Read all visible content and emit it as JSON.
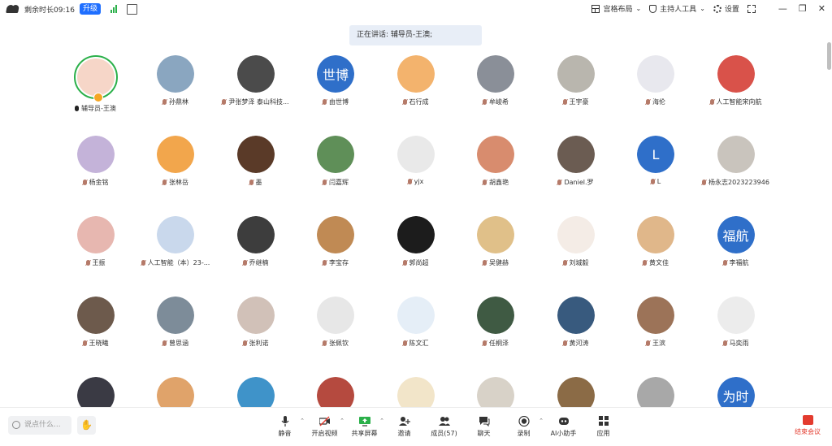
{
  "topbar": {
    "remaining_time": "剩余时长09:16",
    "upgrade_label": "升级",
    "layout_label": "宫格布局",
    "host_tools_label": "主持人工具",
    "settings_label": "设置"
  },
  "speaking": "正在讲话: 辅导员-王澳;",
  "participants": [
    {
      "name": "辅导员-王澳",
      "color": "#f6d6c8",
      "text": "",
      "speaker": true
    },
    {
      "name": "孙鼎林",
      "color": "#8aa6c0",
      "text": ""
    },
    {
      "name": "尹张梦泽 泰山科技...",
      "color": "#4b4b4b",
      "text": ""
    },
    {
      "name": "由世博",
      "color": "#2f6fc9",
      "text": "世博"
    },
    {
      "name": "石行成",
      "color": "#f3b36d",
      "text": ""
    },
    {
      "name": "牟峻希",
      "color": "#8a8f98",
      "text": ""
    },
    {
      "name": "王宇豪",
      "color": "#b9b6ae",
      "text": ""
    },
    {
      "name": "海伦",
      "color": "#e8e8ee",
      "text": ""
    },
    {
      "name": "人工智能宋向航",
      "color": "#d9524a",
      "text": ""
    },
    {
      "name": "杨金铭",
      "color": "#c4b3d9",
      "text": ""
    },
    {
      "name": "张林岳",
      "color": "#f2a64c",
      "text": ""
    },
    {
      "name": "墨",
      "color": "#5a3a28",
      "text": ""
    },
    {
      "name": "闫嘉辉",
      "color": "#5f8f58",
      "text": ""
    },
    {
      "name": "yjx",
      "color": "#e9e9e9",
      "text": ""
    },
    {
      "name": "胡鑫艳",
      "color": "#d88c6e",
      "text": ""
    },
    {
      "name": "Daniel.罗",
      "color": "#6b5c52",
      "text": ""
    },
    {
      "name": "L",
      "color": "#2f6fc9",
      "text": "L"
    },
    {
      "name": "杨永志2023223946",
      "color": "#c9c4bd",
      "text": ""
    },
    {
      "name": "王振",
      "color": "#e7b7b0",
      "text": ""
    },
    {
      "name": "人工智能（本）23-...",
      "color": "#c9d8ec",
      "text": ""
    },
    {
      "name": "乔继楠",
      "color": "#3d3d3d",
      "text": ""
    },
    {
      "name": "李宝存",
      "color": "#c08a54",
      "text": ""
    },
    {
      "name": "郭尚超",
      "color": "#1c1c1c",
      "text": ""
    },
    {
      "name": "吴健赫",
      "color": "#e0c089",
      "text": ""
    },
    {
      "name": "刘城毅",
      "color": "#f4ece6",
      "text": ""
    },
    {
      "name": "黄文佳",
      "color": "#e0b78a",
      "text": ""
    },
    {
      "name": "李福航",
      "color": "#2f6fc9",
      "text": "福航"
    },
    {
      "name": "王晓曦",
      "color": "#6d5a4c",
      "text": ""
    },
    {
      "name": "曾思涵",
      "color": "#7d8c99",
      "text": ""
    },
    {
      "name": "张利诺",
      "color": "#d1c1b8",
      "text": ""
    },
    {
      "name": "张佩钦",
      "color": "#e7e7e7",
      "text": ""
    },
    {
      "name": "陈文汇",
      "color": "#e5eef7",
      "text": ""
    },
    {
      "name": "任桐泽",
      "color": "#3f5a43",
      "text": ""
    },
    {
      "name": "黄河涛",
      "color": "#385a7e",
      "text": ""
    },
    {
      "name": "王滨",
      "color": "#9c7358",
      "text": ""
    },
    {
      "name": "马奕雨",
      "color": "#ececec",
      "text": ""
    },
    {
      "name": "",
      "color": "#3a3a44",
      "text": ""
    },
    {
      "name": "",
      "color": "#e0a36a",
      "text": ""
    },
    {
      "name": "",
      "color": "#3f93c9",
      "text": ""
    },
    {
      "name": "",
      "color": "#b54a3f",
      "text": ""
    },
    {
      "name": "",
      "color": "#f2e5c9",
      "text": ""
    },
    {
      "name": "",
      "color": "#d8d2c8",
      "text": ""
    },
    {
      "name": "",
      "color": "#8b6b46",
      "text": ""
    },
    {
      "name": "",
      "color": "#a8a8a8",
      "text": ""
    },
    {
      "name": "",
      "color": "#2f6fc9",
      "text": "为时"
    }
  ],
  "bottombar": {
    "chat_placeholder": "说点什么...",
    "mute_label": "静音",
    "video_label": "开启视频",
    "share_label": "共享屏幕",
    "invite_label": "邀请",
    "members_label": "成员(57)",
    "chat_label": "聊天",
    "record_label": "录制",
    "ai_label": "AI小助手",
    "apps_label": "应用",
    "end_label": "结束会议"
  }
}
